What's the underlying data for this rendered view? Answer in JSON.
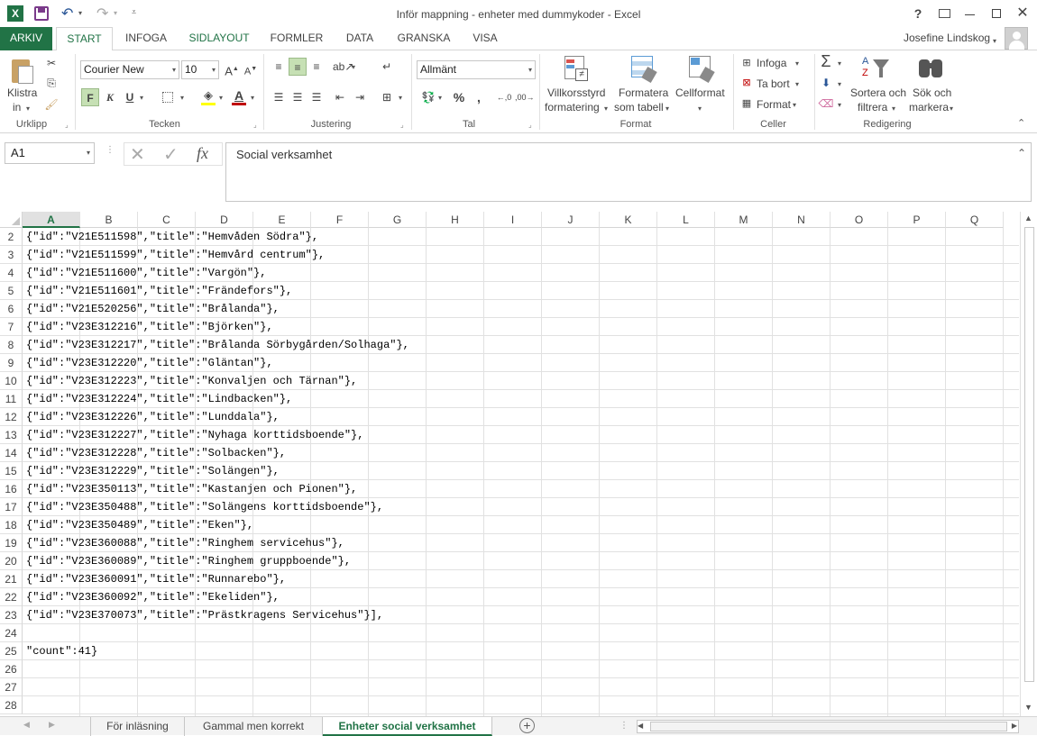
{
  "window": {
    "title": "Inför mappning - enheter med dummykoder - Excel",
    "help": "?",
    "user": "Josefine Lindskog"
  },
  "tabs": [
    {
      "label": "ARKIV"
    },
    {
      "label": "START"
    },
    {
      "label": "INFOGA"
    },
    {
      "label": "SIDLAYOUT"
    },
    {
      "label": "FORMLER"
    },
    {
      "label": "DATA"
    },
    {
      "label": "GRANSKA"
    },
    {
      "label": "VISA"
    }
  ],
  "ribbon": {
    "clipboard": {
      "paste_line1": "Klistra",
      "paste_line2": "in",
      "label": "Urklipp"
    },
    "font": {
      "name": "Courier New",
      "size": "10",
      "bold": "F",
      "italic": "K",
      "underline": "U",
      "label": "Tecken"
    },
    "alignment": {
      "label": "Justering"
    },
    "number": {
      "format": "Allmänt",
      "percent": "%",
      "comma": ",",
      "label": "Tal"
    },
    "styles": {
      "cond_line1": "Villkorsstyrd",
      "cond_line2": "formatering",
      "table_line1": "Formatera",
      "table_line2": "som tabell",
      "cell": "Cellformat",
      "label": "Format"
    },
    "cells": {
      "insert": "Infoga",
      "delete": "Ta bort",
      "format": "Format",
      "label": "Celler"
    },
    "editing": {
      "sort_line1": "Sortera och",
      "sort_line2": "filtrera",
      "find_line1": "Sök och",
      "find_line2": "markera",
      "label": "Redigering"
    }
  },
  "formula_bar": {
    "name_box": "A1",
    "fx": "fx",
    "content": "Social verksamhet"
  },
  "grid": {
    "columns": [
      "A",
      "B",
      "C",
      "D",
      "E",
      "F",
      "G",
      "H",
      "I",
      "J",
      "K",
      "L",
      "M",
      "N",
      "O",
      "P",
      "Q"
    ],
    "selected_column": "A",
    "rows": [
      {
        "num": "2",
        "text": "{\"id\":\"V21E511598\",\"title\":\"Hemvåden Södra\"},"
      },
      {
        "num": "3",
        "text": "{\"id\":\"V21E511599\",\"title\":\"Hemvård centrum\"},"
      },
      {
        "num": "4",
        "text": "{\"id\":\"V21E511600\",\"title\":\"Vargön\"},"
      },
      {
        "num": "5",
        "text": "{\"id\":\"V21E511601\",\"title\":\"Frändefors\"},"
      },
      {
        "num": "6",
        "text": "{\"id\":\"V21E520256\",\"title\":\"Brålanda\"},"
      },
      {
        "num": "7",
        "text": "{\"id\":\"V23E312216\",\"title\":\"Björken\"},"
      },
      {
        "num": "8",
        "text": "{\"id\":\"V23E312217\",\"title\":\"Brålanda Sörbygården/Solhaga\"},"
      },
      {
        "num": "9",
        "text": "{\"id\":\"V23E312220\",\"title\":\"Gläntan\"},"
      },
      {
        "num": "10",
        "text": "{\"id\":\"V23E312223\",\"title\":\"Konvaljen och Tärnan\"},"
      },
      {
        "num": "11",
        "text": "{\"id\":\"V23E312224\",\"title\":\"Lindbacken\"},"
      },
      {
        "num": "12",
        "text": "{\"id\":\"V23E312226\",\"title\":\"Lunddala\"},"
      },
      {
        "num": "13",
        "text": "{\"id\":\"V23E312227\",\"title\":\"Nyhaga korttidsboende\"},"
      },
      {
        "num": "14",
        "text": "{\"id\":\"V23E312228\",\"title\":\"Solbacken\"},"
      },
      {
        "num": "15",
        "text": "{\"id\":\"V23E312229\",\"title\":\"Solängen\"},"
      },
      {
        "num": "16",
        "text": "{\"id\":\"V23E350113\",\"title\":\"Kastanjen och Pionen\"},"
      },
      {
        "num": "17",
        "text": "{\"id\":\"V23E350488\",\"title\":\"Solängens korttidsboende\"},"
      },
      {
        "num": "18",
        "text": "{\"id\":\"V23E350489\",\"title\":\"Eken\"},"
      },
      {
        "num": "19",
        "text": "{\"id\":\"V23E360088\",\"title\":\"Ringhem servicehus\"},"
      },
      {
        "num": "20",
        "text": "{\"id\":\"V23E360089\",\"title\":\"Ringhem gruppboende\"},"
      },
      {
        "num": "21",
        "text": "{\"id\":\"V23E360091\",\"title\":\"Runnarebo\"},"
      },
      {
        "num": "22",
        "text": "{\"id\":\"V23E360092\",\"title\":\"Ekeliden\"},"
      },
      {
        "num": "23",
        "text": "{\"id\":\"V23E370073\",\"title\":\"Prästkragens Servicehus\"}],"
      },
      {
        "num": "24",
        "text": ""
      },
      {
        "num": "25",
        "text": "\"count\":41}"
      },
      {
        "num": "26",
        "text": ""
      },
      {
        "num": "27",
        "text": ""
      },
      {
        "num": "28",
        "text": ""
      }
    ]
  },
  "sheets": [
    {
      "label": "För inläsning"
    },
    {
      "label": "Gammal men korrekt"
    },
    {
      "label": "Enheter social verksamhet"
    }
  ],
  "colors": {
    "accent": "#217346",
    "font_color_bar": "#c00000",
    "highlight_bar": "#ffff00"
  }
}
